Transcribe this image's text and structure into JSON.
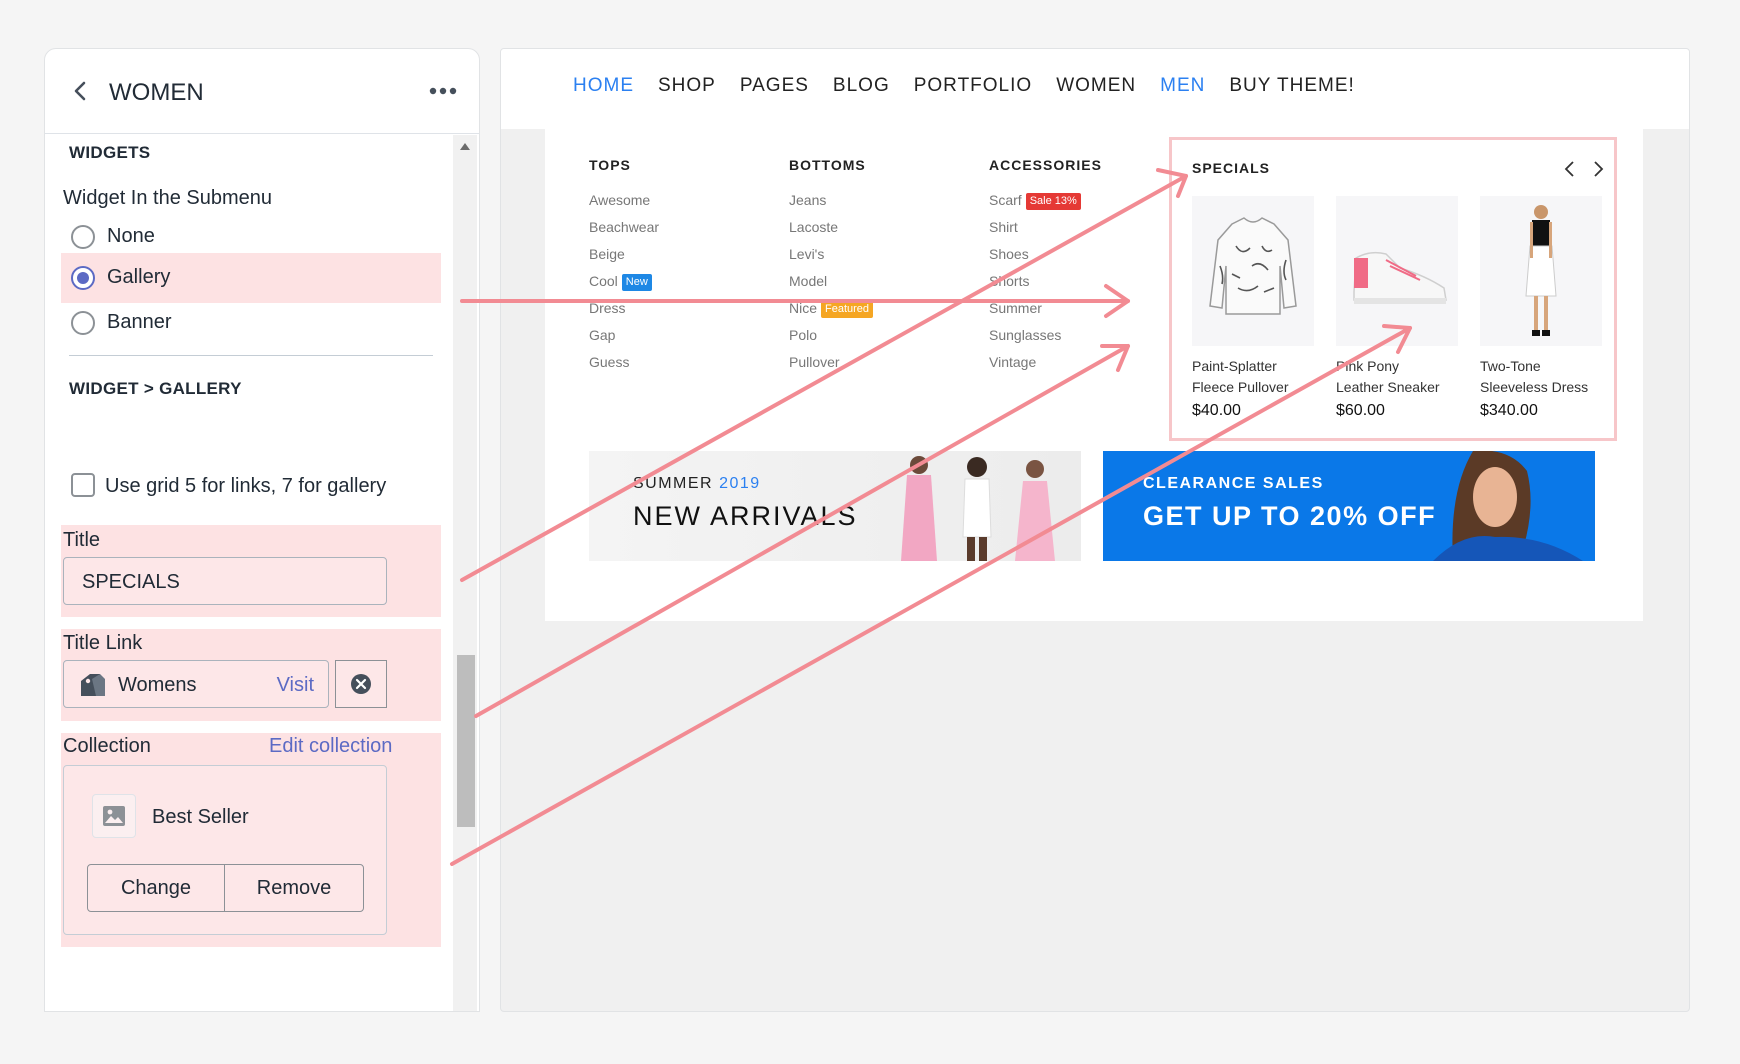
{
  "panel": {
    "title": "WOMEN",
    "widgets_heading": "WIDGETS",
    "submenu_label": "Widget In the Submenu",
    "radio_options": [
      "None",
      "Gallery",
      "Banner"
    ],
    "radio_selected": "Gallery",
    "gallery_heading": "WIDGET > GALLERY",
    "grid_checkbox_label": "Use grid 5 for links, 7 for gallery",
    "title_label": "Title",
    "title_value": "SPECIALS",
    "title_link_label": "Title Link",
    "title_link_value": "Womens",
    "visit_label": "Visit",
    "collection_label": "Collection",
    "edit_collection_label": "Edit collection",
    "collection_value": "Best Seller",
    "change_label": "Change",
    "remove_label": "Remove"
  },
  "preview": {
    "nav": [
      "HOME",
      "SHOP",
      "PAGES",
      "BLOG",
      "PORTFOLIO",
      "WOMEN",
      "MEN",
      "BUY THEME!"
    ],
    "nav_active": [
      "HOME",
      "MEN"
    ],
    "columns": [
      {
        "heading": "TOPS",
        "items": [
          {
            "label": "Awesome"
          },
          {
            "label": "Beachwear"
          },
          {
            "label": "Beige"
          },
          {
            "label": "Cool",
            "badge": "New",
            "badge_color": "#1e88e5"
          },
          {
            "label": "Dress"
          },
          {
            "label": "Gap"
          },
          {
            "label": "Guess"
          }
        ]
      },
      {
        "heading": "BOTTOMS",
        "items": [
          {
            "label": "Jeans"
          },
          {
            "label": "Lacoste"
          },
          {
            "label": "Levi's"
          },
          {
            "label": "Model"
          },
          {
            "label": "Nice",
            "badge": "Featured",
            "badge_color": "#f5a623"
          },
          {
            "label": "Polo"
          },
          {
            "label": "Pullover"
          }
        ]
      },
      {
        "heading": "ACCESSORIES",
        "items": [
          {
            "label": "Scarf",
            "badge": "Sale 13%",
            "badge_color": "#e53935"
          },
          {
            "label": "Shirt"
          },
          {
            "label": "Shoes"
          },
          {
            "label": "Shorts"
          },
          {
            "label": "Summer"
          },
          {
            "label": "Sunglasses"
          },
          {
            "label": "Vintage"
          }
        ]
      }
    ],
    "specials": {
      "title": "SPECIALS",
      "products": [
        {
          "name1": "Paint-Splatter",
          "name2": "Fleece Pullover",
          "price": "$40.00"
        },
        {
          "name1": "Pink Pony",
          "name2": "Leather Sneaker",
          "price": "$60.00"
        },
        {
          "name1": "Two-Tone",
          "name2": "Sleeveless Dress",
          "price": "$340.00"
        }
      ]
    },
    "banner_left": {
      "pre": "SUMMER",
      "year": "2019",
      "headline": "NEW ARRIVALS"
    },
    "banner_right": {
      "sub": "CLEARANCE SALES",
      "headline": "GET UP TO 20% OFF"
    }
  },
  "colors": {
    "accent": "#5c6ac4",
    "highlight": "#fde2e3",
    "arrow": "#f28b93",
    "link_blue": "#2b80f1"
  }
}
